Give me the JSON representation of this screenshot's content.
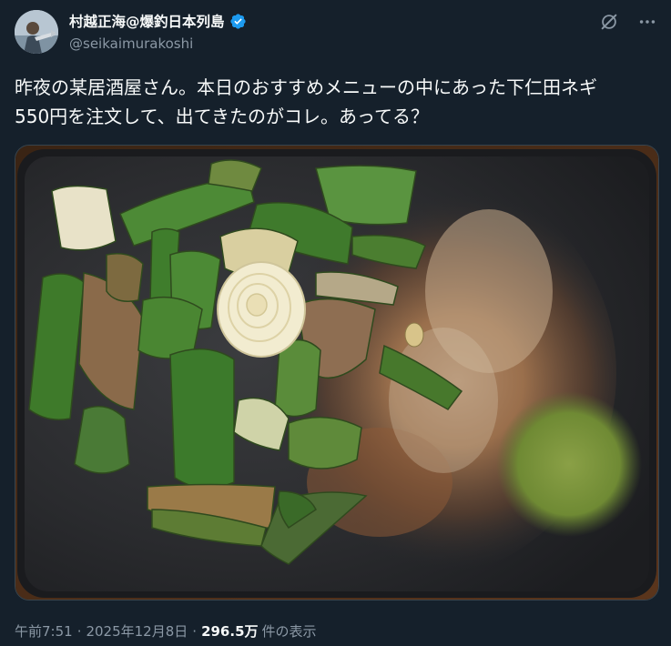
{
  "author": {
    "name": "村越正海@爆釣日本列島",
    "handle": "@seikaimurakoshi",
    "verified": true,
    "verified_color": "#1d9bf0"
  },
  "actions": {
    "grok_icon": "grok-icon",
    "more_icon": "more-icon"
  },
  "tweet": {
    "text": "昨夜の某居酒屋さん。本日のおすすめメニューの中にあった下仁田ネギ\n550円を注文して、出てきたのがコレ。あってる？",
    "photo_icon": "food-photo"
  },
  "meta": {
    "time": "午前7:51",
    "separator": "·",
    "date": "2025年12月8日",
    "views_count": "296.5万",
    "views_label": "件の表示"
  },
  "colors": {
    "background": "#15202b",
    "text_primary": "#f7f9f9",
    "text_secondary": "#8b98a5"
  }
}
